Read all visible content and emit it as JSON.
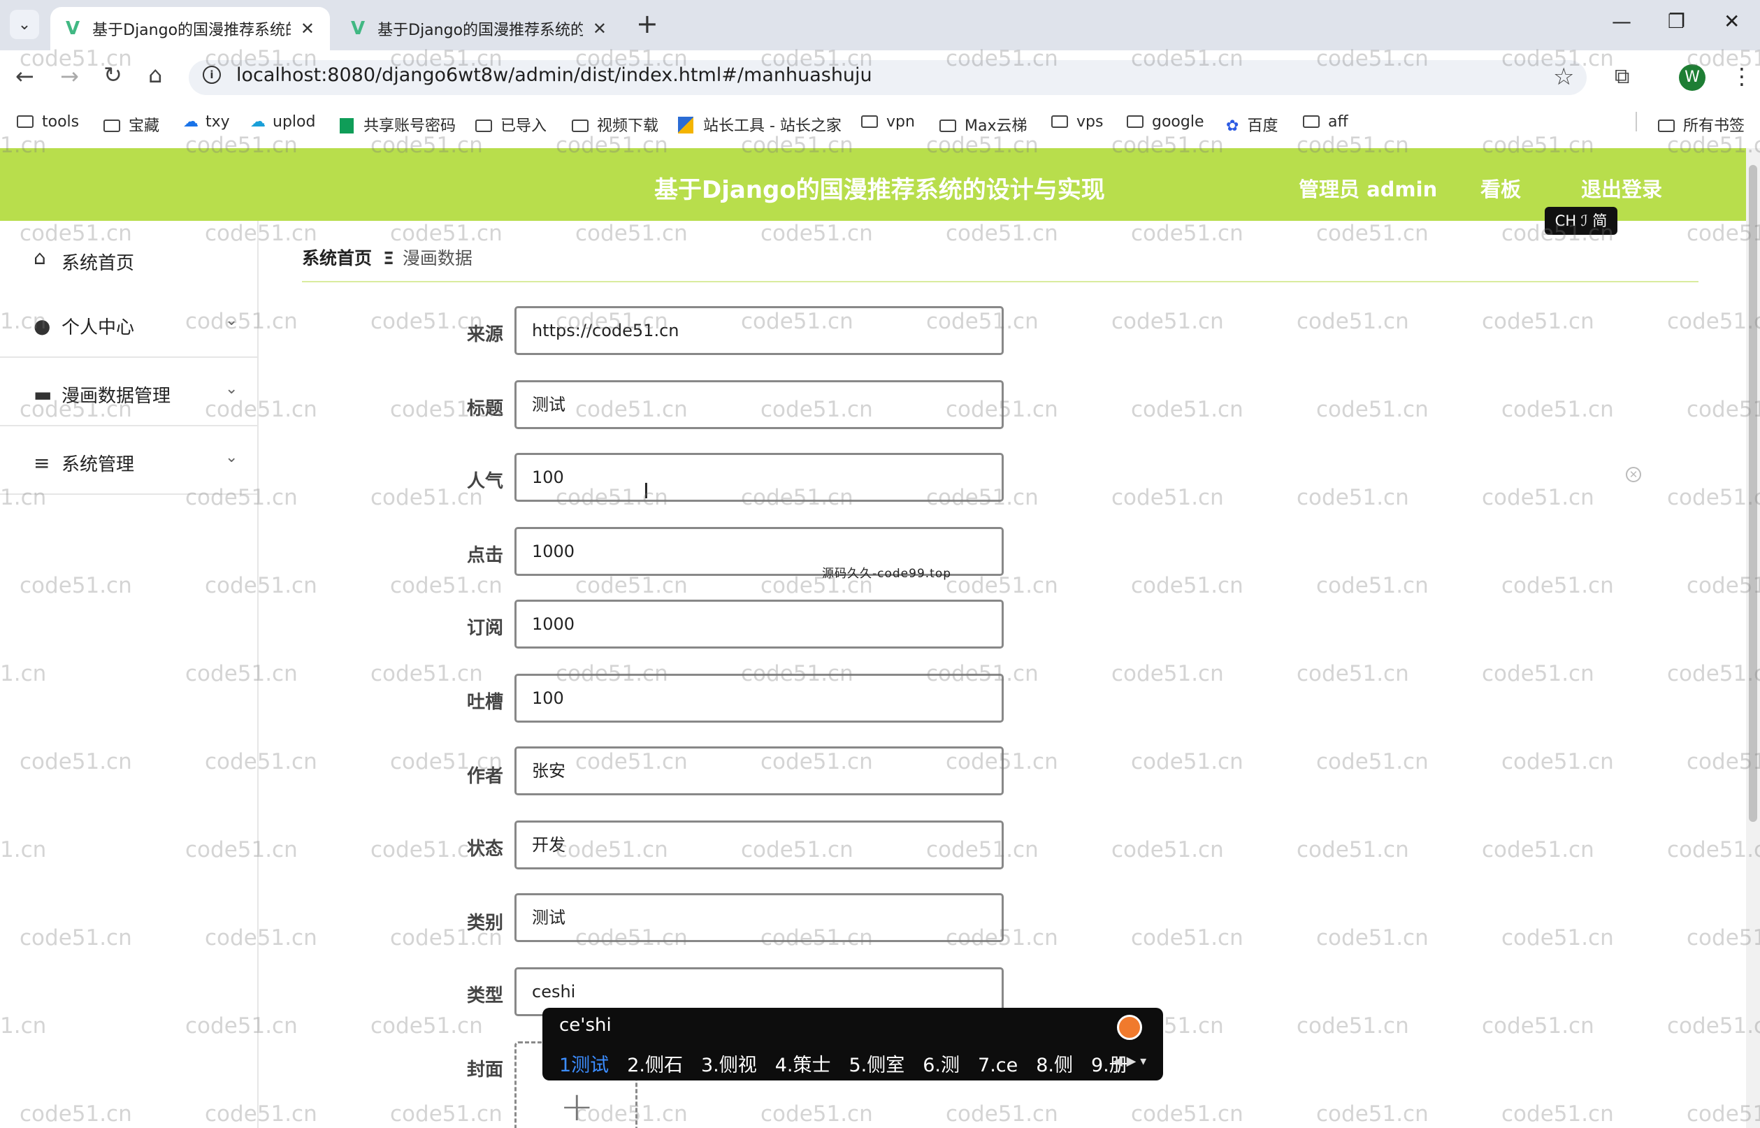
{
  "browser": {
    "tabs": [
      {
        "title": "基于Django的国漫推荐系统的设计与实现",
        "active": true
      },
      {
        "title": "基于Django的国漫推荐系统的设计与实现",
        "active": false
      }
    ],
    "new_tab_icon": "plus",
    "url": "localhost:8080/django6wt8w/admin/dist/index.html#/manhuashuju",
    "profile_initial": "W",
    "bookmarks": [
      "tools",
      "宝藏",
      "txy",
      "uplod",
      "共享账号密码",
      "已导入",
      "视频下载",
      "站长工具 - 站长之家",
      "vpn",
      "Max云梯",
      "vps",
      "google",
      "百度",
      "aff"
    ],
    "all_bookmarks": "所有书签"
  },
  "header": {
    "title": "基于Django的国漫推荐系统的设计与实现",
    "user": "管理员 admin",
    "board": "看板",
    "logout": "退出登录",
    "bg_color": "#b8de4c"
  },
  "ime_indicator": "CH ℐ 简",
  "sidebar": {
    "items": [
      {
        "label": "系统首页",
        "icon": "home-icon",
        "has_arrow": false
      },
      {
        "label": "个人中心",
        "icon": "user-icon",
        "has_arrow": true
      },
      {
        "label": "漫画数据管理",
        "icon": "briefcase-icon",
        "has_arrow": true
      },
      {
        "label": "系统管理",
        "icon": "menu-lines-icon",
        "has_arrow": true
      }
    ]
  },
  "breadcrumb": {
    "home": "系统首页",
    "separator": "Ξ",
    "current": "漫画数据"
  },
  "form": {
    "fields": [
      {
        "label": "来源",
        "value": "https://code51.cn"
      },
      {
        "label": "标题",
        "value": "测试"
      },
      {
        "label": "人气",
        "value": "100"
      },
      {
        "label": "点击",
        "value": "1000"
      },
      {
        "label": "订阅",
        "value": "1000"
      },
      {
        "label": "吐槽",
        "value": "100"
      },
      {
        "label": "作者",
        "value": "张安"
      },
      {
        "label": "状态",
        "value": "开发"
      },
      {
        "label": "类别",
        "value": "测试"
      },
      {
        "label": "类型",
        "value": "ceshi"
      }
    ],
    "cover_label": "封面",
    "cover_upload_icon": "plus-icon"
  },
  "ime": {
    "composition": "ce'shi",
    "candidates": [
      "1测试",
      "2.侧石",
      "3.侧视",
      "4.策士",
      "5.侧室",
      "6.测",
      "7.ce",
      "8.侧",
      "9.册"
    ]
  },
  "watermarks": {
    "main": "code51.cn",
    "partial": "1.cn",
    "center": "源码久久-code99.top"
  }
}
